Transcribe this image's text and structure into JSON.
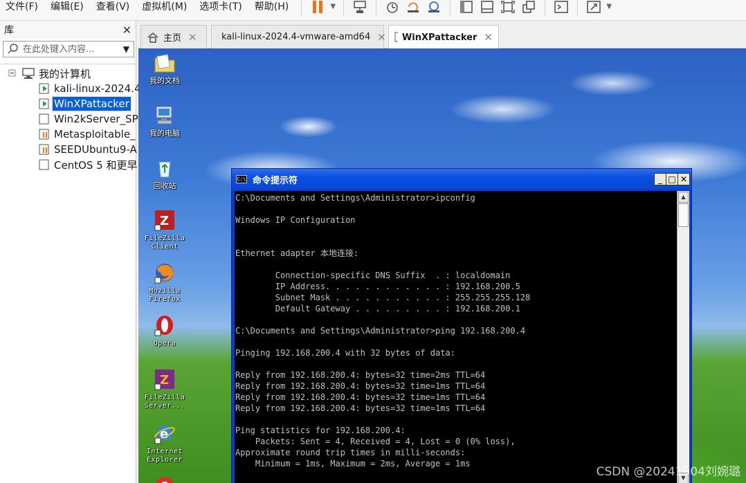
{
  "menubar": {
    "items": [
      "文件(F)",
      "编辑(E)",
      "查看(V)",
      "虚拟机(M)",
      "选项卡(T)",
      "帮助(H)"
    ]
  },
  "library": {
    "title": "库",
    "close": "✕",
    "search_placeholder": "在此处键入内容...",
    "tree": {
      "root": "我的计算机",
      "items": [
        {
          "label": "kali-linux-2024.4",
          "state": "running"
        },
        {
          "label": "WinXPattacker",
          "state": "running",
          "selected": true
        },
        {
          "label": "Win2kServer_SP",
          "state": "off"
        },
        {
          "label": "Metasploitable_",
          "state": "paused"
        },
        {
          "label": "SEEDUbuntu9-A",
          "state": "paused"
        },
        {
          "label": "CentOS 5 和更早",
          "state": "off"
        }
      ]
    }
  },
  "tabs": [
    {
      "label": "主页",
      "icon": "home-icon",
      "active": false
    },
    {
      "label": "kali-linux-2024.4-vmware-amd64",
      "icon": "vm-running-icon",
      "active": false
    },
    {
      "label": "WinXPattacker",
      "icon": "vm-running-icon",
      "active": true
    }
  ],
  "desktop": {
    "icons": [
      {
        "label": "我的文档",
        "icon": "my-documents-icon"
      },
      {
        "label": "我的电脑",
        "icon": "my-computer-icon"
      },
      {
        "label": "回收站",
        "icon": "recycle-bin-icon"
      },
      {
        "label": "FileZilla\nClient",
        "icon": "filezilla-client-icon"
      },
      {
        "label": "Mozilla\nFirefox",
        "icon": "firefox-icon"
      },
      {
        "label": "Opera",
        "icon": "opera-icon"
      },
      {
        "label": "FileZilla\nServer...",
        "icon": "filezilla-server-icon"
      },
      {
        "label": "Internet\nExplorer",
        "icon": "internet-explorer-icon"
      }
    ]
  },
  "cmd": {
    "title": "命令提示符",
    "title_icon_text": "C:\\",
    "buttons": {
      "minimize": "_",
      "maximize": "□",
      "close": "✕"
    },
    "lines": [
      "C:\\Documents and Settings\\Administrator>ipconfig",
      "",
      "Windows IP Configuration",
      "",
      "",
      "Ethernet adapter 本地连接:",
      "",
      "        Connection-specific DNS Suffix  . : localdomain",
      "        IP Address. . . . . . . . . . . . : 192.168.200.5",
      "        Subnet Mask . . . . . . . . . . . : 255.255.255.128",
      "        Default Gateway . . . . . . . . . : 192.168.200.1",
      "",
      "C:\\Documents and Settings\\Administrator>ping 192.168.200.4",
      "",
      "Pinging 192.168.200.4 with 32 bytes of data:",
      "",
      "Reply from 192.168.200.4: bytes=32 time=2ms TTL=64",
      "Reply from 192.168.200.4: bytes=32 time=1ms TTL=64",
      "Reply from 192.168.200.4: bytes=32 time=1ms TTL=64",
      "Reply from 192.168.200.4: bytes=32 time=1ms TTL=64",
      "",
      "Ping statistics for 192.168.200.4:",
      "    Packets: Sent = 4, Received = 4, Lost = 0 (0% loss),",
      "Approximate round trip times in milli-seconds:",
      "    Minimum = 1ms, Maximum = 2ms, Average = 1ms"
    ]
  },
  "watermark": "CSDN @20241904刘婉璐",
  "colors": {
    "selection": "#0a5fd6",
    "xp_title": "#0a46d4",
    "vmware_orange": "#e8741c"
  }
}
